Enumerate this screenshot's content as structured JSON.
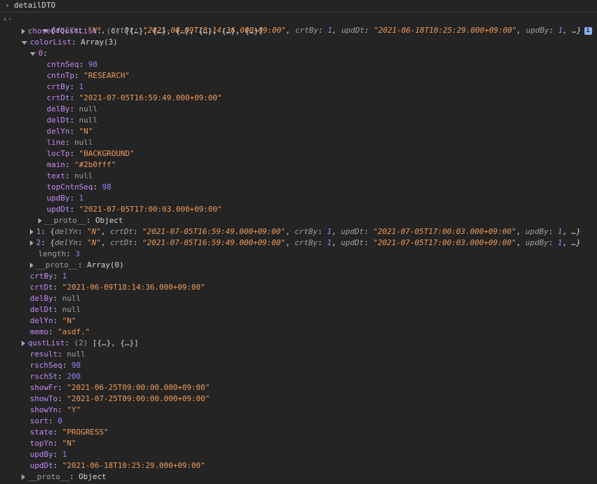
{
  "command": "detailDTO",
  "summary": {
    "open": "{",
    "pairs": [
      {
        "k": "delYn",
        "v": "\"N\"",
        "t": "str"
      },
      {
        "k": "crtDt",
        "v": "\"2021-06-09T18:14:36.000+09:00\"",
        "t": "str"
      },
      {
        "k": "crtBy",
        "v": "1",
        "t": "num"
      },
      {
        "k": "updDt",
        "v": "\"2021-06-18T10:25:29.000+09:00\"",
        "t": "str"
      },
      {
        "k": "updBy",
        "v": "1",
        "t": "num"
      }
    ],
    "tail": "…}"
  },
  "rows": [
    {
      "indent": 1,
      "tri": "right",
      "key": "choseOfQustList",
      "keycls": "kp",
      "pre": " (6) ",
      "pre_cls": "dim",
      "val": "[{…}, {…}, {…}, {…}, {…}, {…}]",
      "vcls": ""
    },
    {
      "indent": 1,
      "tri": "down",
      "key": "colorList",
      "keycls": "kp",
      "val": "Array(3)",
      "vcls": ""
    },
    {
      "indent": 2,
      "tri": "down",
      "key": "0",
      "keycls": "kp",
      "val": "",
      "vcls": ""
    },
    {
      "indent": 3,
      "key": "cntnSeq",
      "keycls": "kp",
      "val": "98",
      "vcls": "num"
    },
    {
      "indent": 3,
      "key": "cntnTp",
      "keycls": "kp",
      "val": "\"RESEARCH\"",
      "vcls": "str"
    },
    {
      "indent": 3,
      "key": "crtBy",
      "keycls": "kp",
      "val": "1",
      "vcls": "num"
    },
    {
      "indent": 3,
      "key": "crtDt",
      "keycls": "kp",
      "val": "\"2021-07-05T16:59:49.000+09:00\"",
      "vcls": "str"
    },
    {
      "indent": 3,
      "key": "delBy",
      "keycls": "kp",
      "val": "null",
      "vcls": "nul"
    },
    {
      "indent": 3,
      "key": "delDt",
      "keycls": "kp",
      "val": "null",
      "vcls": "nul"
    },
    {
      "indent": 3,
      "key": "delYn",
      "keycls": "kp",
      "val": "\"N\"",
      "vcls": "str"
    },
    {
      "indent": 3,
      "key": "line",
      "keycls": "kp",
      "val": "null",
      "vcls": "nul"
    },
    {
      "indent": 3,
      "key": "locTp",
      "keycls": "kp",
      "val": "\"BACKGROUND\"",
      "vcls": "str"
    },
    {
      "indent": 3,
      "key": "main",
      "keycls": "kp",
      "val": "\"#2b0fff\"",
      "vcls": "str"
    },
    {
      "indent": 3,
      "key": "text",
      "keycls": "kp",
      "val": "null",
      "vcls": "nul"
    },
    {
      "indent": 3,
      "key": "topCntnSeq",
      "keycls": "kp",
      "val": "98",
      "vcls": "num"
    },
    {
      "indent": 3,
      "key": "updBy",
      "keycls": "kp",
      "val": "1",
      "vcls": "num"
    },
    {
      "indent": 3,
      "key": "updDt",
      "keycls": "kp",
      "val": "\"2021-07-05T17:00:03.000+09:00\"",
      "vcls": "str"
    },
    {
      "indent": 3,
      "tri": "right",
      "key": "__proto__",
      "keycls": "k-dim",
      "val": "Object",
      "vcls": ""
    },
    {
      "indent": 2,
      "tri": "right",
      "key": "1",
      "keycls": "kp",
      "val": "",
      "vcls": "",
      "summary": [
        {
          "k": "delYn",
          "v": "\"N\"",
          "t": "str"
        },
        {
          "k": "crtDt",
          "v": "\"2021-07-05T16:59:49.000+09:00\"",
          "t": "str"
        },
        {
          "k": "crtBy",
          "v": "1",
          "t": "num"
        },
        {
          "k": "updDt",
          "v": "\"2021-07-05T17:00:03.000+09:00\"",
          "t": "str"
        },
        {
          "k": "updBy",
          "v": "1",
          "t": "num"
        }
      ]
    },
    {
      "indent": 2,
      "tri": "right",
      "key": "2",
      "keycls": "kp",
      "val": "",
      "vcls": "",
      "summary": [
        {
          "k": "delYn",
          "v": "\"N\"",
          "t": "str"
        },
        {
          "k": "crtDt",
          "v": "\"2021-07-05T16:59:49.000+09:00\"",
          "t": "str"
        },
        {
          "k": "crtBy",
          "v": "1",
          "t": "num"
        },
        {
          "k": "updDt",
          "v": "\"2021-07-05T17:00:03.000+09:00\"",
          "t": "str"
        },
        {
          "k": "updBy",
          "v": "1",
          "t": "num"
        }
      ]
    },
    {
      "indent": 2,
      "key": "length",
      "keycls": "k-dim",
      "val": "3",
      "vcls": "num"
    },
    {
      "indent": 2,
      "tri": "right",
      "key": "__proto__",
      "keycls": "k-dim",
      "val": "Array(0)",
      "vcls": ""
    },
    {
      "indent": 1,
      "key": "crtBy",
      "keycls": "kp",
      "val": "1",
      "vcls": "num"
    },
    {
      "indent": 1,
      "key": "crtDt",
      "keycls": "kp",
      "val": "\"2021-06-09T18:14:36.000+09:00\"",
      "vcls": "str"
    },
    {
      "indent": 1,
      "key": "delBy",
      "keycls": "kp",
      "val": "null",
      "vcls": "nul"
    },
    {
      "indent": 1,
      "key": "delDt",
      "keycls": "kp",
      "val": "null",
      "vcls": "nul"
    },
    {
      "indent": 1,
      "key": "delYn",
      "keycls": "kp",
      "val": "\"N\"",
      "vcls": "str"
    },
    {
      "indent": 1,
      "key": "memo",
      "keycls": "kp",
      "val": "\"asdf.\"",
      "vcls": "str"
    },
    {
      "indent": 1,
      "tri": "right",
      "key": "qustList",
      "keycls": "kp",
      "pre": " (2) ",
      "pre_cls": "dim",
      "val": "[{…}, {…}]",
      "vcls": ""
    },
    {
      "indent": 1,
      "key": "result",
      "keycls": "kp",
      "val": "null",
      "vcls": "nul"
    },
    {
      "indent": 1,
      "key": "rschSeq",
      "keycls": "kp",
      "val": "98",
      "vcls": "num"
    },
    {
      "indent": 1,
      "key": "rschSt",
      "keycls": "kp",
      "val": "200",
      "vcls": "num"
    },
    {
      "indent": 1,
      "key": "showFr",
      "keycls": "kp",
      "val": "\"2021-06-25T09:00:00.000+09:00\"",
      "vcls": "str"
    },
    {
      "indent": 1,
      "key": "showTo",
      "keycls": "kp",
      "val": "\"2021-07-25T09:00:00.000+09:00\"",
      "vcls": "str"
    },
    {
      "indent": 1,
      "key": "showYn",
      "keycls": "kp",
      "val": "\"Y\"",
      "vcls": "str"
    },
    {
      "indent": 1,
      "key": "sort",
      "keycls": "kp",
      "val": "0",
      "vcls": "num"
    },
    {
      "indent": 1,
      "key": "state",
      "keycls": "kp",
      "val": "\"PROGRESS\"",
      "vcls": "str"
    },
    {
      "indent": 1,
      "key": "topYn",
      "keycls": "kp",
      "val": "\"N\"",
      "vcls": "str"
    },
    {
      "indent": 1,
      "key": "updBy",
      "keycls": "kp",
      "val": "1",
      "vcls": "num"
    },
    {
      "indent": 1,
      "key": "updDt",
      "keycls": "kp",
      "val": "\"2021-06-18T10:25:29.000+09:00\"",
      "vcls": "str"
    },
    {
      "indent": 1,
      "tri": "right",
      "key": "__proto__",
      "keycls": "k-dim",
      "val": "Object",
      "vcls": ""
    }
  ],
  "colors": {
    "bg": "#242424",
    "key": "#c58af9",
    "string": "#ef9a5a",
    "number": "#9980ff",
    "null": "#9aa0a6",
    "info": "#8ab4f8"
  },
  "info_glyph": "i"
}
